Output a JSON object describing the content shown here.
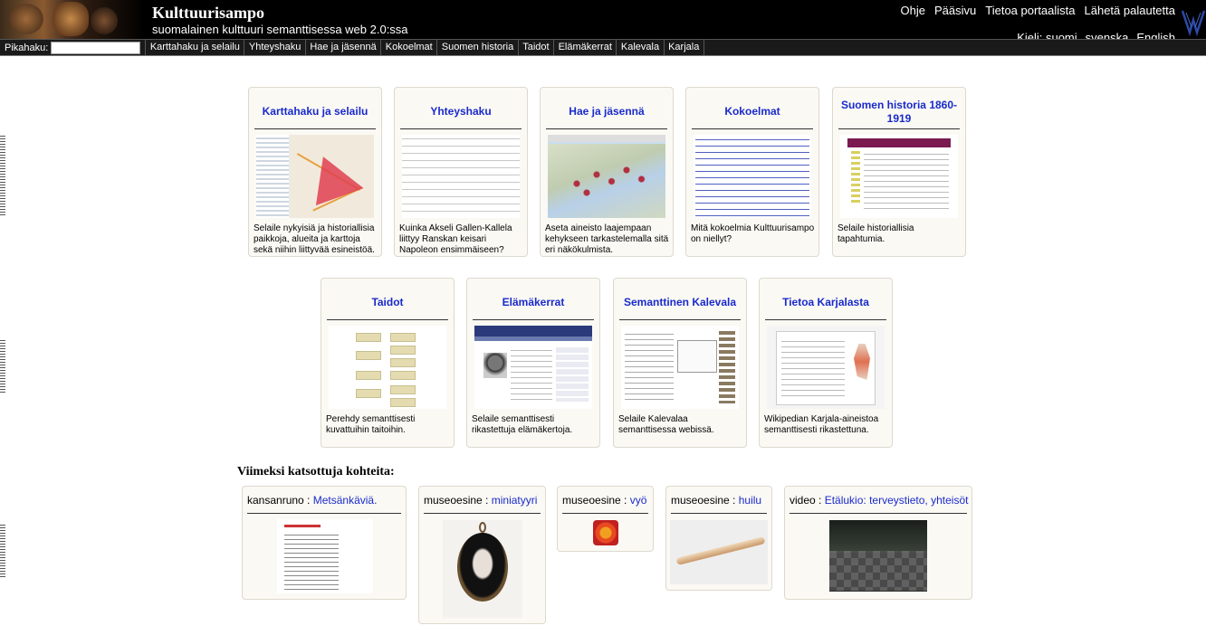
{
  "header": {
    "title": "Kulttuurisampo",
    "subtitle": "suomalainen kulttuuri semanttisessa web 2.0:ssa",
    "links": [
      "Ohje",
      "Pääsivu",
      "Tietoa portaalista",
      "Lähetä palautetta"
    ],
    "language_label": "Kieli: suomi",
    "languages": [
      "svenska",
      "English"
    ]
  },
  "navbar": {
    "quick_search_label": "Pikahaku:",
    "quick_search_value": "",
    "items": [
      "Karttahaku ja selailu",
      "Yhteyshaku",
      "Hae ja jäsennä",
      "Kokoelmat",
      "Suomen historia",
      "Taidot",
      "Elämäkerrat",
      "Kalevala",
      "Karjala"
    ]
  },
  "cards": [
    {
      "title": "Karttahaku ja selailu",
      "desc": "Selaile nykyisiä ja historiallisia paikkoja, alueita ja karttoja sekä niihin liittyvää esineistöä."
    },
    {
      "title": "Yhteyshaku",
      "desc": "Kuinka Akseli Gallen-Kallela liittyy Ranskan keisari Napoleon ensimmäiseen?"
    },
    {
      "title": "Hae ja jäsennä",
      "desc": "Aseta aineisto laajempaan kehykseen tarkastelemalla sitä eri näkökulmista."
    },
    {
      "title": "Kokoelmat",
      "desc": "Mitä kokoelmia Kulttuurisampo on niellyt?"
    },
    {
      "title": "Suomen historia 1860-1919",
      "desc": "Selaile historiallisia tapahtumia."
    },
    {
      "title": "Taidot",
      "desc": "Perehdy semanttisesti kuvattuihin taitoihin."
    },
    {
      "title": "Elämäkerrat",
      "desc": "Selaile semanttisesti rikastettuja elämäkertoja."
    },
    {
      "title": "Semanttinen Kalevala",
      "desc": "Selaile Kalevalaa semanttisessa webissä."
    },
    {
      "title": "Tietoa Karjalasta",
      "desc": "Wikipedian Karjala-aineistoa semanttisesti rikastettuna."
    }
  ],
  "recent": {
    "heading": "Viimeksi katsottuja kohteita:",
    "items": [
      {
        "type": "kansanruno",
        "sep": " : ",
        "name": "Metsänkäviä."
      },
      {
        "type": "museoesine",
        "sep": " : ",
        "name": "miniatyyri"
      },
      {
        "type": "museoesine",
        "sep": " : ",
        "name": "vyö"
      },
      {
        "type": "museoesine",
        "sep": " : ",
        "name": "huilu"
      },
      {
        "type": "video",
        "sep": " : ",
        "name": "Etälukio: terveystieto, yhteisöt"
      }
    ]
  },
  "colors": {
    "link": "#1a2acc",
    "header_bg": "#000000",
    "card_bg": "#faf9f4"
  }
}
